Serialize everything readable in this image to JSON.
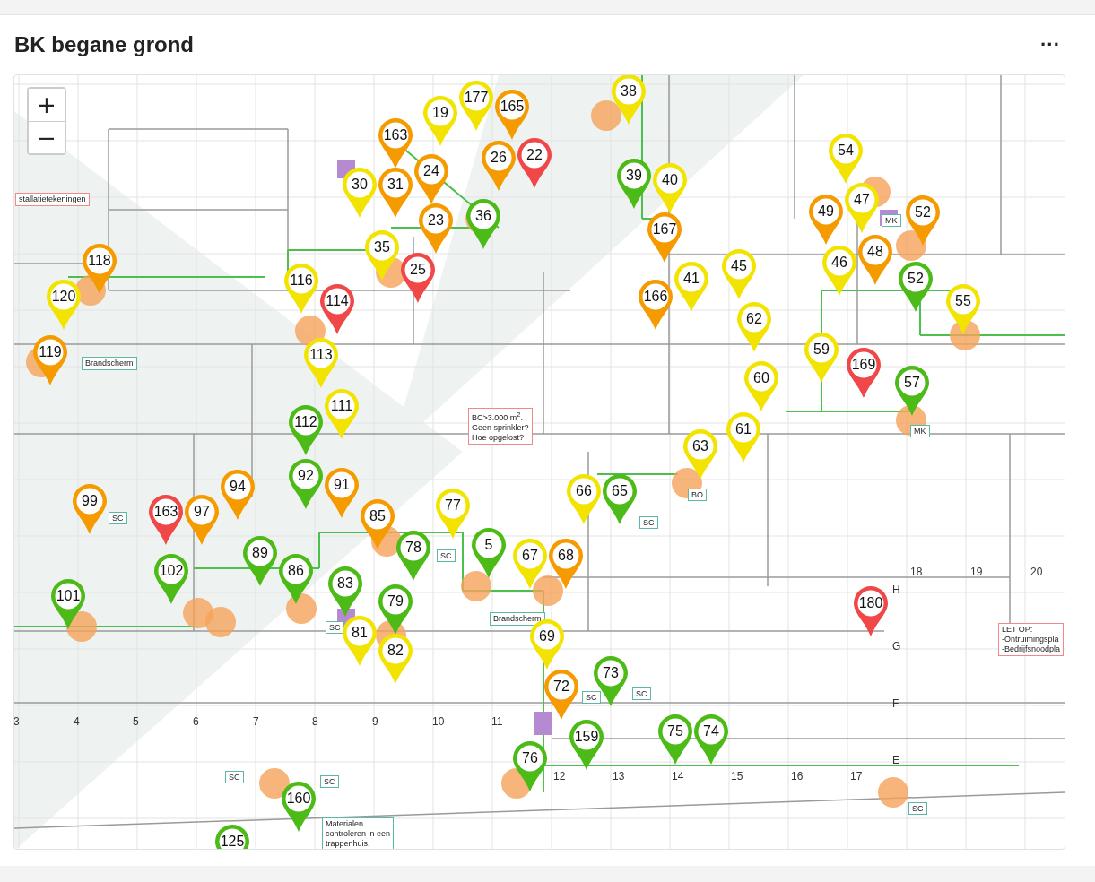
{
  "card": {
    "title": "BK begane grond",
    "menu": "···"
  },
  "map": {
    "zoom_in": "+",
    "zoom_out": "−",
    "callouts": [
      {
        "kind": "red",
        "lines": [
          "stallatietekeningen"
        ]
      },
      {
        "kind": "teal",
        "lines": [
          "Brandscherm"
        ]
      },
      {
        "kind": "red",
        "lines": [
          "BC>3.000 m$^{2}$.",
          "Geen sprinkler?",
          "Hoe opgelost?"
        ]
      },
      {
        "kind": "teal",
        "lines": [
          "Brandscherm"
        ]
      },
      {
        "kind": "red",
        "lines": [
          "LET OP:",
          "-Ontruimingspla",
          "-Bedrijfsnoodpla"
        ]
      },
      {
        "kind": "teal",
        "lines": [
          "Materialen",
          "controleren in een",
          "trappenhuis."
        ]
      }
    ],
    "tags": [
      "SC",
      "SC",
      "SC",
      "SC",
      "SC",
      "SC",
      "SC",
      "SC",
      "SC",
      "MK",
      "MK",
      "BO"
    ],
    "grid_labels": [
      "3",
      "4",
      "5",
      "6",
      "7",
      "8",
      "9",
      "10",
      "11",
      "12",
      "13",
      "14",
      "15",
      "16",
      "17",
      "18",
      "19",
      "20",
      "H",
      "G",
      "F",
      "E"
    ],
    "pins": [
      {
        "label": "38",
        "color": "#f2e400"
      },
      {
        "label": "177",
        "color": "#f2e400"
      },
      {
        "label": "19",
        "color": "#f2e400"
      },
      {
        "label": "165",
        "color": "#f59b00"
      },
      {
        "label": "26",
        "color": "#f59b00"
      },
      {
        "label": "22",
        "color": "#f04848"
      },
      {
        "label": "163",
        "color": "#f59b00"
      },
      {
        "label": "30",
        "color": "#f2e400"
      },
      {
        "label": "31",
        "color": "#f59b00"
      },
      {
        "label": "24",
        "color": "#f59b00"
      },
      {
        "label": "23",
        "color": "#f59b00"
      },
      {
        "label": "36",
        "color": "#4cbb17"
      },
      {
        "label": "35",
        "color": "#f2e400"
      },
      {
        "label": "25",
        "color": "#f04848"
      },
      {
        "label": "39",
        "color": "#4cbb17"
      },
      {
        "label": "40",
        "color": "#f2e400"
      },
      {
        "label": "167",
        "color": "#f59b00"
      },
      {
        "label": "41",
        "color": "#f2e400"
      },
      {
        "label": "166",
        "color": "#f59b00"
      },
      {
        "label": "45",
        "color": "#f2e400"
      },
      {
        "label": "62",
        "color": "#f2e400"
      },
      {
        "label": "54",
        "color": "#f2e400"
      },
      {
        "label": "49",
        "color": "#f59b00"
      },
      {
        "label": "47",
        "color": "#f2e400"
      },
      {
        "label": "46",
        "color": "#f2e400"
      },
      {
        "label": "48",
        "color": "#f59b00"
      },
      {
        "label": "52",
        "color": "#f59b00"
      },
      {
        "label": "52",
        "color": "#4cbb17"
      },
      {
        "label": "55",
        "color": "#f2e400"
      },
      {
        "label": "59",
        "color": "#f2e400"
      },
      {
        "label": "169",
        "color": "#f04848"
      },
      {
        "label": "57",
        "color": "#4cbb17"
      },
      {
        "label": "60",
        "color": "#f2e400"
      },
      {
        "label": "61",
        "color": "#f2e400"
      },
      {
        "label": "63",
        "color": "#f2e400"
      },
      {
        "label": "66",
        "color": "#f2e400"
      },
      {
        "label": "65",
        "color": "#4cbb17"
      },
      {
        "label": "5",
        "color": "#4cbb17"
      },
      {
        "label": "77",
        "color": "#f2e400"
      },
      {
        "label": "67",
        "color": "#f2e400"
      },
      {
        "label": "68",
        "color": "#f59b00"
      },
      {
        "label": "85",
        "color": "#f59b00"
      },
      {
        "label": "78",
        "color": "#4cbb17"
      },
      {
        "label": "79",
        "color": "#4cbb17"
      },
      {
        "label": "83",
        "color": "#4cbb17"
      },
      {
        "label": "81",
        "color": "#f2e400"
      },
      {
        "label": "82",
        "color": "#f2e400"
      },
      {
        "label": "86",
        "color": "#4cbb17"
      },
      {
        "label": "89",
        "color": "#4cbb17"
      },
      {
        "label": "113",
        "color": "#f2e400"
      },
      {
        "label": "112",
        "color": "#4cbb17"
      },
      {
        "label": "111",
        "color": "#f2e400"
      },
      {
        "label": "92",
        "color": "#4cbb17"
      },
      {
        "label": "91",
        "color": "#f59b00"
      },
      {
        "label": "116",
        "color": "#f2e400"
      },
      {
        "label": "114",
        "color": "#f04848"
      },
      {
        "label": "118",
        "color": "#f59b00"
      },
      {
        "label": "120",
        "color": "#f2e400"
      },
      {
        "label": "119",
        "color": "#f59b00"
      },
      {
        "label": "99",
        "color": "#f59b00"
      },
      {
        "label": "94",
        "color": "#f59b00"
      },
      {
        "label": "163",
        "color": "#f04848"
      },
      {
        "label": "97",
        "color": "#f59b00"
      },
      {
        "label": "102",
        "color": "#4cbb17"
      },
      {
        "label": "101",
        "color": "#4cbb17"
      },
      {
        "label": "69",
        "color": "#f2e400"
      },
      {
        "label": "72",
        "color": "#f59b00"
      },
      {
        "label": "73",
        "color": "#4cbb17"
      },
      {
        "label": "159",
        "color": "#4cbb17"
      },
      {
        "label": "76",
        "color": "#4cbb17"
      },
      {
        "label": "75",
        "color": "#4cbb17"
      },
      {
        "label": "74",
        "color": "#4cbb17"
      },
      {
        "label": "160",
        "color": "#4cbb17"
      },
      {
        "label": "125",
        "color": "#4cbb17"
      },
      {
        "label": "180",
        "color": "#f04848"
      }
    ]
  }
}
